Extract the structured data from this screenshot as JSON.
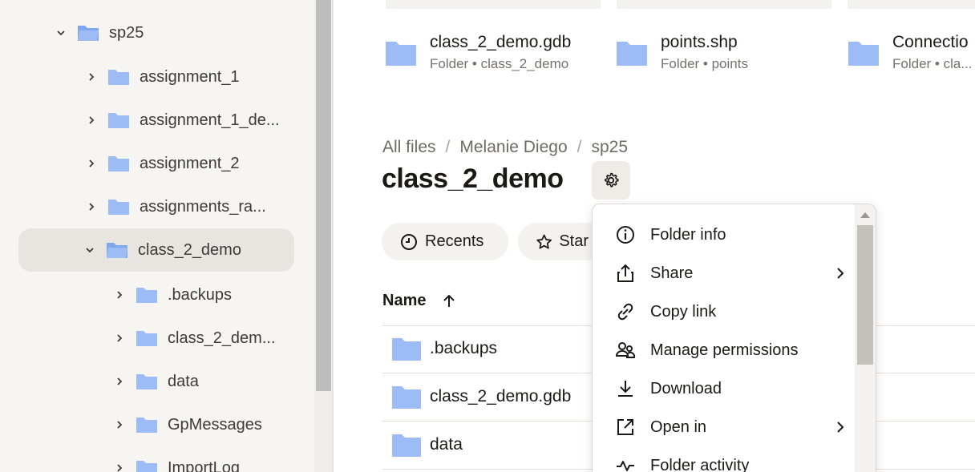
{
  "sidebar": {
    "items": [
      {
        "label": "sp25",
        "expanded": true
      },
      {
        "label": "assignment_1"
      },
      {
        "label": "assignment_1_de..."
      },
      {
        "label": "assignment_2"
      },
      {
        "label": "assignments_ra..."
      },
      {
        "label": "class_2_demo",
        "expanded": true,
        "selected": true
      },
      {
        "label": ".backups"
      },
      {
        "label": "class_2_dem..."
      },
      {
        "label": "data"
      },
      {
        "label": "GpMessages"
      },
      {
        "label": "ImportLog"
      }
    ]
  },
  "suggested": [
    {
      "name": "class_2_demo.gdb",
      "meta": "Folder • class_2_demo"
    },
    {
      "name": "points.shp",
      "meta": "Folder • points"
    },
    {
      "name": "Connectio",
      "meta": "Folder • cla..."
    }
  ],
  "breadcrumb": {
    "items": [
      "All files",
      "Melanie Diego",
      "sp25"
    ],
    "separator": "/"
  },
  "page": {
    "title": "class_2_demo"
  },
  "filters": {
    "recents": "Recents",
    "starred": "Star"
  },
  "table": {
    "name_header": "Name",
    "rows": [
      ".backups",
      "class_2_demo.gdb",
      "data"
    ]
  },
  "menu": {
    "items": [
      {
        "label": "Folder info",
        "icon": "info-icon"
      },
      {
        "label": "Share",
        "icon": "share-icon",
        "submenu": true
      },
      {
        "label": "Copy link",
        "icon": "link-icon"
      },
      {
        "label": "Manage permissions",
        "icon": "people-icon"
      },
      {
        "label": "Download",
        "icon": "download-icon"
      },
      {
        "label": "Open in",
        "icon": "open-in-icon",
        "submenu": true
      },
      {
        "label": "Folder activity",
        "icon": "activity-icon"
      }
    ]
  },
  "colors": {
    "folder": "#9dbbf4",
    "folder_dark": "#7fa6ee",
    "sidebar_bg": "#f7f5f2",
    "selected_bg": "#e8e4df"
  }
}
